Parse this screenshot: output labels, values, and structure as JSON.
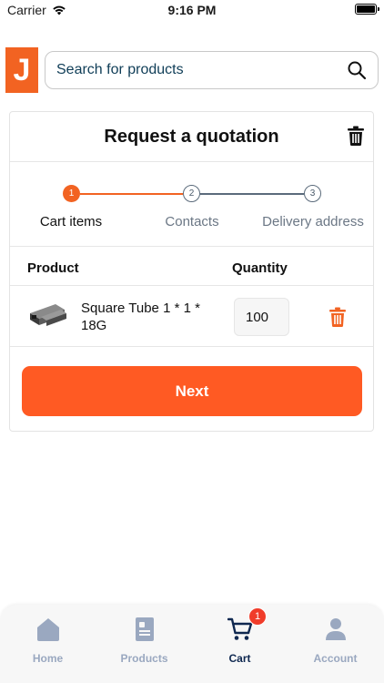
{
  "status_bar": {
    "carrier": "Carrier",
    "time": "9:16 PM"
  },
  "header": {
    "logo_letter": "J",
    "search_placeholder": "Search for products"
  },
  "quotation": {
    "title": "Request a quotation",
    "steps": [
      {
        "number": "1",
        "label": "Cart items",
        "active": true
      },
      {
        "number": "2",
        "label": "Contacts",
        "active": false
      },
      {
        "number": "3",
        "label": "Delivery address",
        "active": false
      }
    ],
    "table": {
      "columns": [
        "Product",
        "Quantity"
      ],
      "rows": [
        {
          "name": "Square Tube 1 * 1 * 18G",
          "quantity": "100"
        }
      ]
    },
    "next_label": "Next"
  },
  "tab_bar": {
    "tabs": [
      {
        "label": "Home",
        "icon": "home-icon",
        "active": false
      },
      {
        "label": "Products",
        "icon": "catalog-icon",
        "active": false
      },
      {
        "label": "Cart",
        "icon": "cart-icon",
        "active": true,
        "badge": "1"
      },
      {
        "label": "Account",
        "icon": "account-icon",
        "active": false
      }
    ]
  },
  "colors": {
    "accent": "#f26322",
    "button": "#ff5a23",
    "active_tab": "#0f2850",
    "inactive_tab": "#9aa8c0",
    "badge": "#f03c2a"
  }
}
